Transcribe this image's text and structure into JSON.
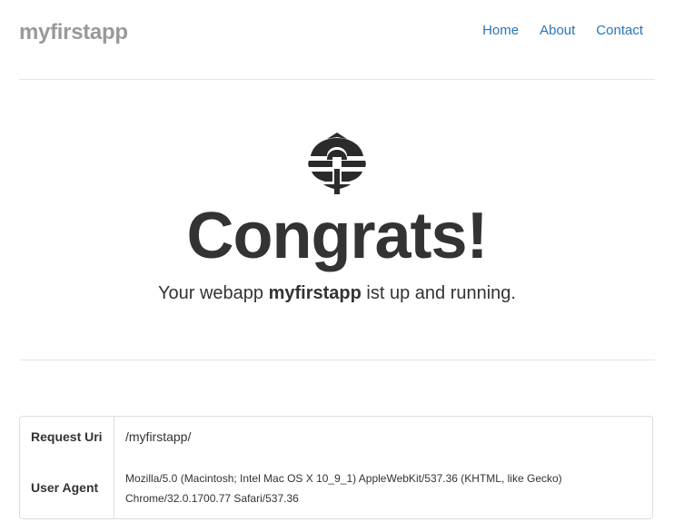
{
  "header": {
    "brand": "myfirstapp",
    "nav": [
      {
        "label": "Home"
      },
      {
        "label": "About"
      },
      {
        "label": "Contact"
      }
    ]
  },
  "hero": {
    "logo_icon": "stylized-globe-logo-icon",
    "headline": "Congrats!",
    "tagline_prefix": "Your webapp ",
    "tagline_app": "myfirstapp",
    "tagline_suffix": " ist up and running."
  },
  "info": {
    "rows": [
      {
        "key": "Request Uri",
        "value": "/myfirstapp/"
      },
      {
        "key": "User Agent",
        "value": "Mozilla/5.0 (Macintosh; Intel Mac OS X 10_9_1) AppleWebKit/537.36 (KHTML, like Gecko) Chrome/32.0.1700.77 Safari/537.36"
      }
    ]
  },
  "colors": {
    "link": "#2a74b8",
    "brand": "#999999",
    "text": "#333333",
    "divider": "#e5e5e5"
  }
}
